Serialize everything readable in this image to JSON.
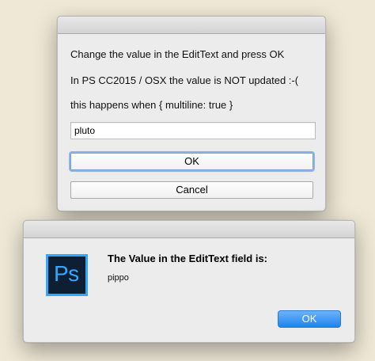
{
  "dialog1": {
    "line1": "Change the value in the EditText and press OK",
    "line2": "In PS CC2015 / OSX the value is NOT updated :-(",
    "line3": "this happens when { multiline: true }",
    "edit_value": "pluto",
    "ok_label": "OK",
    "cancel_label": "Cancel"
  },
  "dialog2": {
    "app_icon_text": "Ps",
    "app_icon": "photoshop-icon",
    "heading": "The Value in the EditText field is:",
    "value": "pippo",
    "ok_label": "OK"
  },
  "colors": {
    "background": "#efe8d6",
    "accent_blue": "#1f83ee",
    "ps_blue": "#31a8ff",
    "ps_dark": "#0e1f33"
  }
}
